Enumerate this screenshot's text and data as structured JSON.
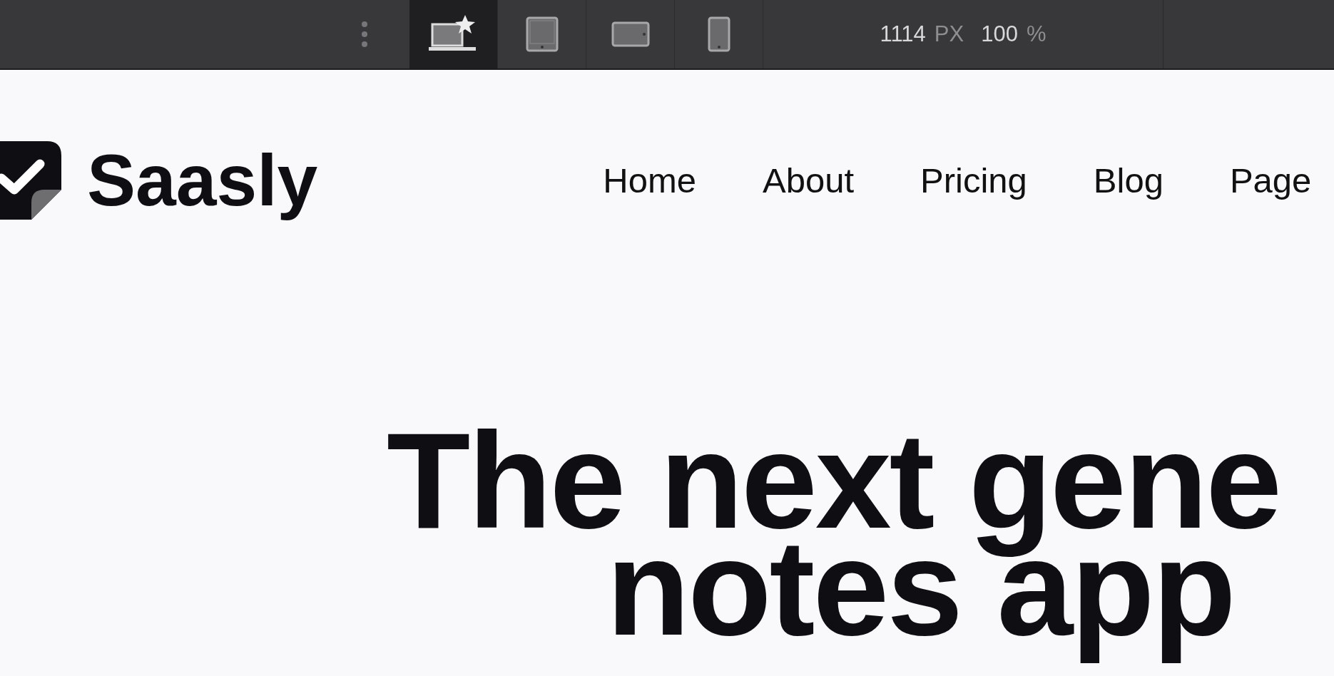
{
  "toolbar": {
    "devices": [
      {
        "kind": "laptop",
        "selected": true
      },
      {
        "kind": "tablet",
        "selected": false
      },
      {
        "kind": "tablet-landscape",
        "selected": false
      },
      {
        "kind": "phone",
        "selected": false
      }
    ],
    "width_value": "1114",
    "width_unit": "PX",
    "zoom_value": "100",
    "zoom_unit": "%"
  },
  "header": {
    "brand": "Saasly",
    "nav": [
      "Home",
      "About",
      "Pricing",
      "Blog",
      "Page"
    ]
  },
  "hero": {
    "lines": [
      "The next gene",
      "notes app"
    ]
  }
}
